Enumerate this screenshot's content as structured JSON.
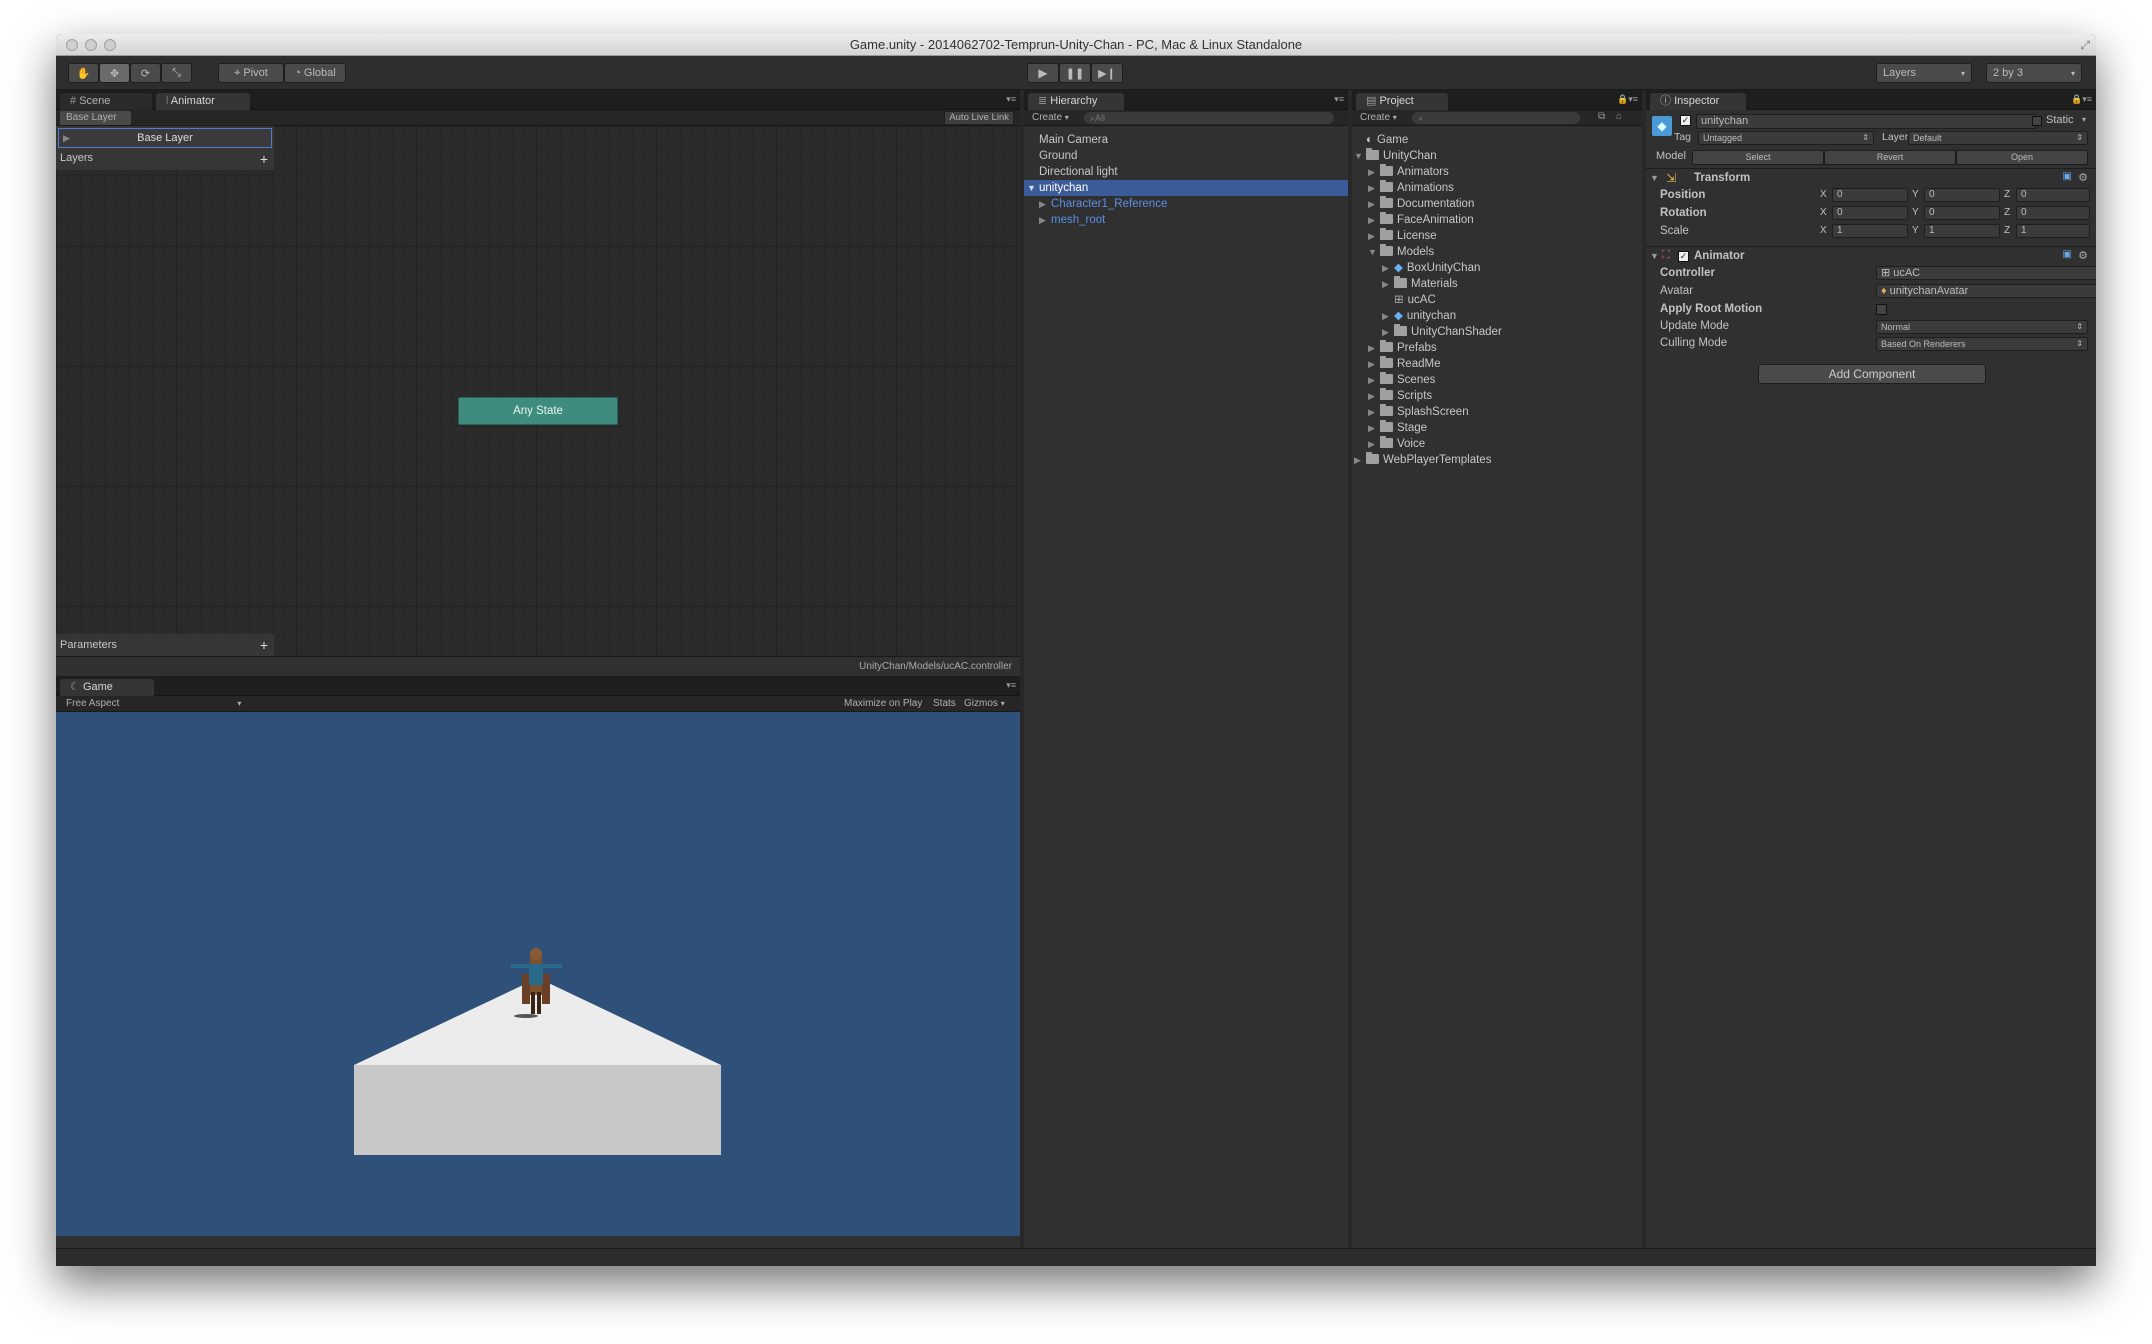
{
  "window": {
    "title": "Game.unity - 2014062702-Temprun-Unity-Chan - PC, Mac & Linux Standalone"
  },
  "toolbar": {
    "tools": [
      "hand-tool",
      "move-tool",
      "rotate-tool",
      "scale-tool"
    ],
    "pivot_label": "Pivot",
    "global_label": "Global",
    "play_controls": [
      "play",
      "pause",
      "step"
    ],
    "layers_label": "Layers",
    "layout_label": "2 by 3"
  },
  "animator_panel": {
    "tabs": [
      {
        "label": "Scene"
      },
      {
        "label": "Animator"
      }
    ],
    "breadcrumb": "Base Layer",
    "auto_live_link": "Auto Live Link",
    "base_layer": "Base Layer",
    "layers_label": "Layers",
    "any_state": "Any State",
    "parameters_label": "Parameters",
    "status_path": "UnityChan/Models/ucAC.controller",
    "graph_bg": "#2b2b2b",
    "any_state_color": "#3d8c7e"
  },
  "game_panel": {
    "tab": "Game",
    "aspect": "Free Aspect",
    "maximize_on_play": "Maximize on Play",
    "stats": "Stats",
    "gizmos": "Gizmos",
    "sky_color": "#2f5079"
  },
  "hierarchy": {
    "tab": "Hierarchy",
    "create": "Create",
    "search_placeholder": "All",
    "items": [
      {
        "label": "Main Camera"
      },
      {
        "label": "Ground"
      },
      {
        "label": "Directional light"
      },
      {
        "label": "unitychan"
      },
      {
        "label": "Character1_Reference"
      },
      {
        "label": "mesh_root"
      }
    ]
  },
  "project": {
    "tab": "Project",
    "create": "Create",
    "items": [
      {
        "label": "Game"
      },
      {
        "label": "UnityChan"
      },
      {
        "label": "Animators"
      },
      {
        "label": "Animations"
      },
      {
        "label": "Documentation"
      },
      {
        "label": "FaceAnimation"
      },
      {
        "label": "License"
      },
      {
        "label": "Models"
      },
      {
        "label": "BoxUnityChan"
      },
      {
        "label": "Materials"
      },
      {
        "label": "ucAC"
      },
      {
        "label": "unitychan"
      },
      {
        "label": "UnityChanShader"
      },
      {
        "label": "Prefabs"
      },
      {
        "label": "ReadMe"
      },
      {
        "label": "Scenes"
      },
      {
        "label": "Scripts"
      },
      {
        "label": "SplashScreen"
      },
      {
        "label": "Stage"
      },
      {
        "label": "Voice"
      },
      {
        "label": "WebPlayerTemplates"
      }
    ]
  },
  "inspector": {
    "tab": "Inspector",
    "object_name": "unitychan",
    "static_label": "Static",
    "tag_label": "Tag",
    "tag_value": "Untagged",
    "layer_label": "Layer",
    "layer_value": "Default",
    "model_label": "Model",
    "model_buttons": [
      "Select",
      "Revert",
      "Open"
    ],
    "transform": {
      "title": "Transform",
      "position_label": "Position",
      "rotation_label": "Rotation",
      "scale_label": "Scale",
      "axis": [
        "X",
        "Y",
        "Z"
      ],
      "position": [
        "0",
        "0",
        "0"
      ],
      "rotation": [
        "0",
        "0",
        "0"
      ],
      "scale": [
        "1",
        "1",
        "1"
      ]
    },
    "animator": {
      "title": "Animator",
      "controller_label": "Controller",
      "controller_value": "ucAC",
      "avatar_label": "Avatar",
      "avatar_value": "unitychanAvatar",
      "apply_root_motion_label": "Apply Root Motion",
      "update_mode_label": "Update Mode",
      "update_mode_value": "Normal",
      "culling_mode_label": "Culling Mode",
      "culling_mode_value": "Based On Renderers"
    },
    "add_component": "Add Component"
  }
}
